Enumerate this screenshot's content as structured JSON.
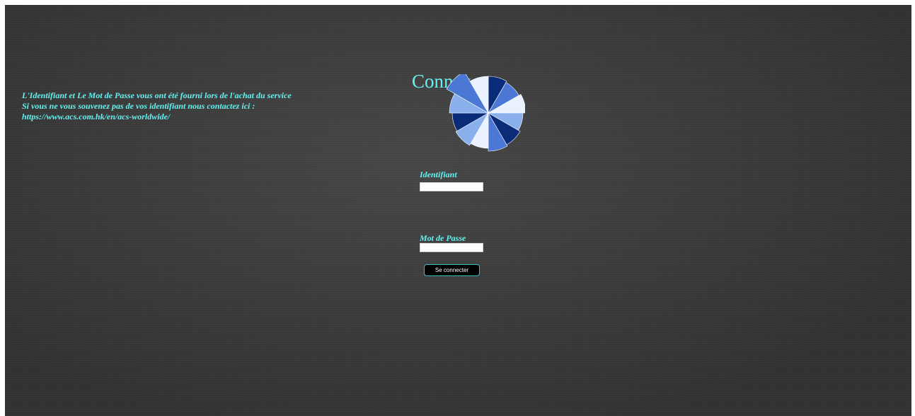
{
  "colors": {
    "accent_text": "#66f0f0",
    "background": "#3d3d3d",
    "button_bg": "#000000",
    "button_border": "#39c2c2",
    "button_text": "#ffffff"
  },
  "info": {
    "line1": "L'Identifiant et Le Mot de Passe vous ont été fourni lors de l'achat du service",
    "line2": "Si vous ne vous souvenez pas de vos identifiant nous contactez ici :",
    "line3": "https://www.acs.com.hk/en/acs-worldwide/"
  },
  "login": {
    "title": "Connex",
    "logo": {
      "icon": "blue-pinwheel-logo-icon",
      "colors": [
        "#0a2c78",
        "#4a78d4",
        "#eaf2ff",
        "#8ab0ec"
      ]
    },
    "username": {
      "label": "Identifiant",
      "value": ""
    },
    "password": {
      "label": "Mot de Passe",
      "value": ""
    },
    "submit_label": "Se connecter"
  }
}
